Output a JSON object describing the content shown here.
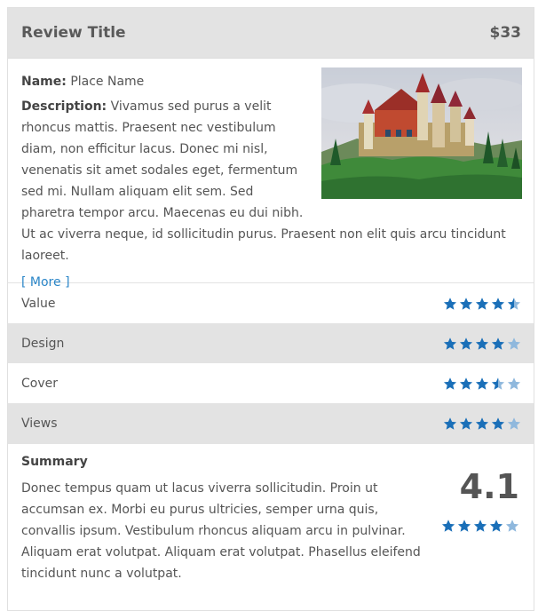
{
  "header": {
    "title": "Review Title",
    "price": "$33"
  },
  "info": {
    "name_label": "Name:",
    "name_value": "Place Name",
    "description_label": "Description:",
    "description_value": "Vivamus sed purus a velit rhoncus mattis. Praesent nec vestibulum diam, non efficitur lacus. Donec mi nisl, venenatis sit amet sodales eget, fermentum sed mi. Nullam aliquam elit sem. Sed pharetra tempor arcu. Maecenas eu dui nibh. Ut ac viverra neque, id sollicitudin purus. Praesent non elit quis arcu tincidunt laoreet.",
    "more_link": "[ More ]",
    "image_icon": "castle-photo"
  },
  "ratings": [
    {
      "label": "Value",
      "stars": 4.5
    },
    {
      "label": "Design",
      "stars": 4
    },
    {
      "label": "Cover",
      "stars": 3.5
    },
    {
      "label": "Views",
      "stars": 4
    }
  ],
  "summary": {
    "title": "Summary",
    "text": "Donec tempus quam ut lacus viverra sollicitudin. Proin ut accumsan ex. Morbi eu purus ultricies, semper urna quis, convallis ipsum. Vestibulum rhoncus aliquam arcu in pulvinar. Aliquam erat volutpat. Aliquam erat volutpat. Phasellus eleifend tincidunt nunc a volutpat.",
    "score": "4.1",
    "stars": 4
  },
  "colors": {
    "star_full": "#1a6fb8",
    "star_empty": "#8fb8dd",
    "header_bg": "#e3e3e3",
    "link": "#2b86c8"
  }
}
